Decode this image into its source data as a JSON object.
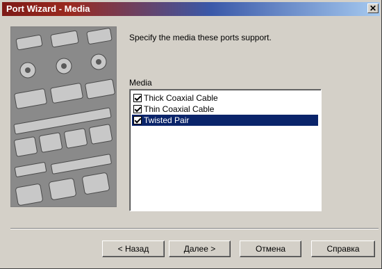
{
  "window": {
    "title": "Port Wizard - Media"
  },
  "content": {
    "prompt": "Specify the media these ports support.",
    "media_label": "Media"
  },
  "media_list": {
    "items": [
      {
        "label": "Thick Coaxial Cable",
        "checked": true,
        "selected": false
      },
      {
        "label": "Thin Coaxial Cable",
        "checked": true,
        "selected": false
      },
      {
        "label": "Twisted Pair",
        "checked": true,
        "selected": true
      }
    ]
  },
  "buttons": {
    "back": "< Назад",
    "next": "Далее >",
    "cancel": "Отмена",
    "help": "Справка"
  },
  "icons": {
    "close": "close-icon"
  },
  "colors": {
    "selection": "#0a246a",
    "dialog": "#d4d0c8"
  }
}
